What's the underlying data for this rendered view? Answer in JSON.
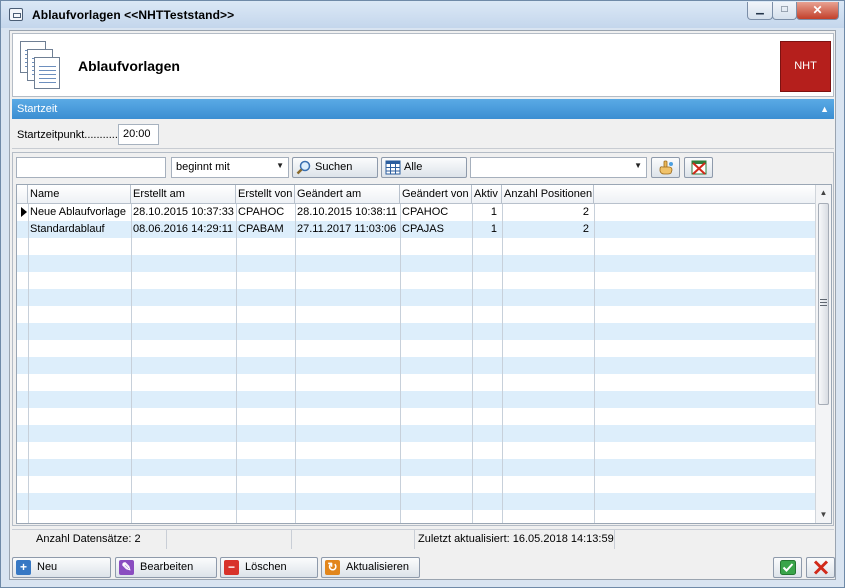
{
  "window": {
    "title": "Ablaufvorlagen  <<NHTTeststand>>"
  },
  "header": {
    "title": "Ablaufvorlagen",
    "badge": "NHT"
  },
  "section": {
    "title": "Startzeit"
  },
  "startzeit": {
    "label": "Startzeitpunkt...........",
    "value": "20:00"
  },
  "filter": {
    "text_value": "",
    "mode_value": "beginnt mit",
    "search_label": "Suchen",
    "all_label": "Alle",
    "column_value": ""
  },
  "table": {
    "columns": [
      "Name",
      "Erstellt am",
      "Erstellt von",
      "Geändert am",
      "Geändert von",
      "Aktiv",
      "Anzahl Positionen"
    ],
    "rows": [
      [
        "Neue Ablaufvorlage",
        "28.10.2015 10:37:33",
        "CPAHOC",
        "28.10.2015 10:38:11",
        "CPAHOC",
        "1",
        "2"
      ],
      [
        "Standardablauf",
        "08.06.2016 14:29:11",
        "CPABAM",
        "27.11.2017 11:03:06",
        "CPAJAS",
        "1",
        "2"
      ]
    ]
  },
  "status": {
    "count_text": "Anzahl Datensätze: 2",
    "updated_text": "Zuletzt aktualisiert: 16.05.2018 14:13:59"
  },
  "buttons": {
    "new": "Neu",
    "edit": "Bearbeiten",
    "delete": "Löschen",
    "refresh": "Aktualisieren"
  },
  "colors": {
    "section_bar": "#3b8ed2",
    "badge": "#b51f1c",
    "stripe": "#ddeefb"
  }
}
